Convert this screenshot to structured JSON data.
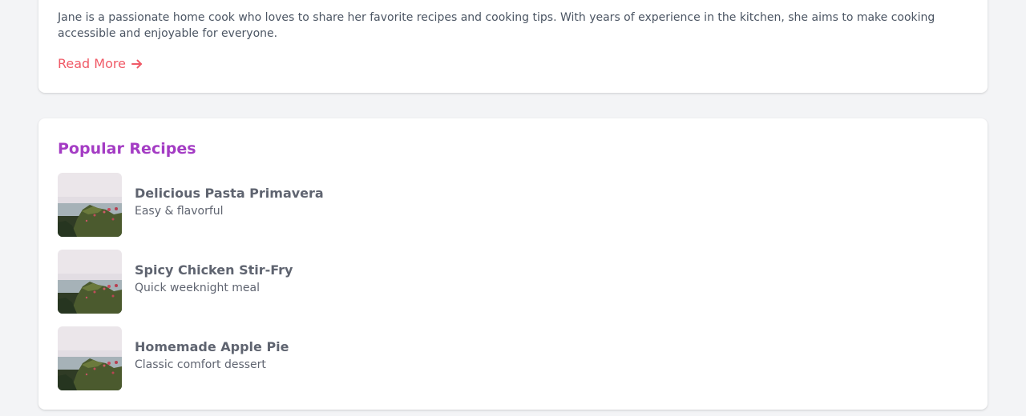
{
  "author_bio": {
    "text": "Jane is a passionate home cook who loves to share her favorite recipes and cooking tips. With years of experience in the kitchen, she aims to make cooking accessible and enjoyable for everyone.",
    "read_more_label": "Read More",
    "read_more_icon": "arrow-right-icon"
  },
  "popular_recipes": {
    "title": "Popular Recipes",
    "items": [
      {
        "name": "Delicious Pasta Primavera",
        "description": "Easy & flavorful"
      },
      {
        "name": "Spicy Chicken Stir-Fry",
        "description": "Quick weeknight meal"
      },
      {
        "name": "Homemade Apple Pie",
        "description": "Classic comfort dessert"
      }
    ]
  },
  "colors": {
    "page_background": "#f3f4f6",
    "card_background": "#ffffff",
    "link": "#f05a67",
    "section_title": "#a43cc4",
    "body_text": "#4b5563",
    "recipe_text": "#5f6470"
  }
}
